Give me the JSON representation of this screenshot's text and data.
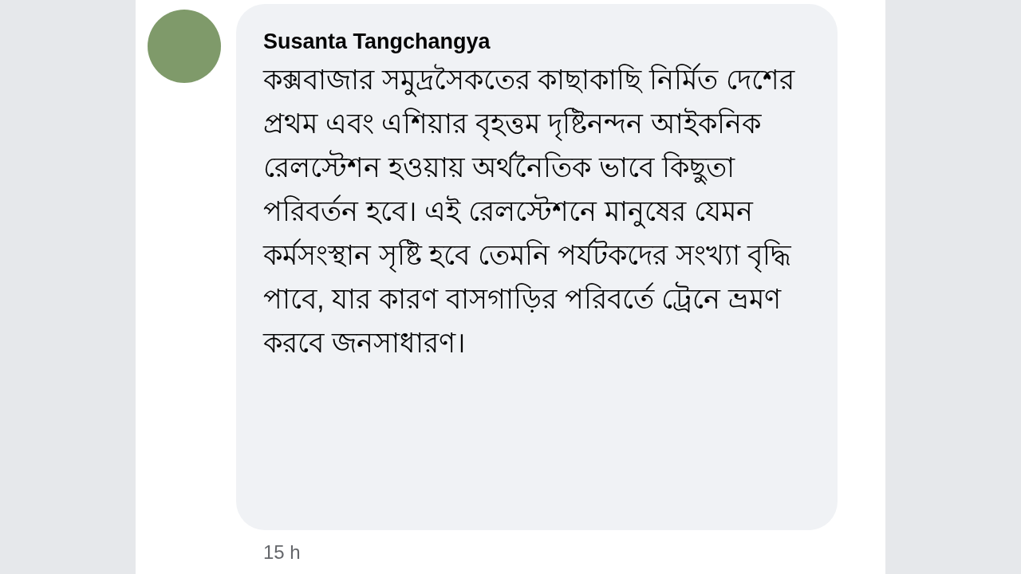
{
  "comment": {
    "author": "Susanta Tangchangya",
    "text": "কক্সবাজার সমুদ্রসৈকতের কাছাকাছি নির্মিত দেশের প্রথম এবং এশিয়ার বৃহত্তম দৃষ্টিনন্দন আইকনিক রেলস্টেশন হওয়ায় অর্থনৈতিক ভাবে কিছুতা পরিবর্তন হবে। এই রেলস্টেশনে মানুষের যেমন কর্মসংস্থান সৃষ্টি হবে তেমনি পর্যটকদের সংখ্যা বৃদ্ধি পাবে, যার কারণ বাসগাড়ির পরিবর্তে ট্রেনে ভ্রমণ করবে জনসাধারণ।",
    "time": "15 h"
  }
}
